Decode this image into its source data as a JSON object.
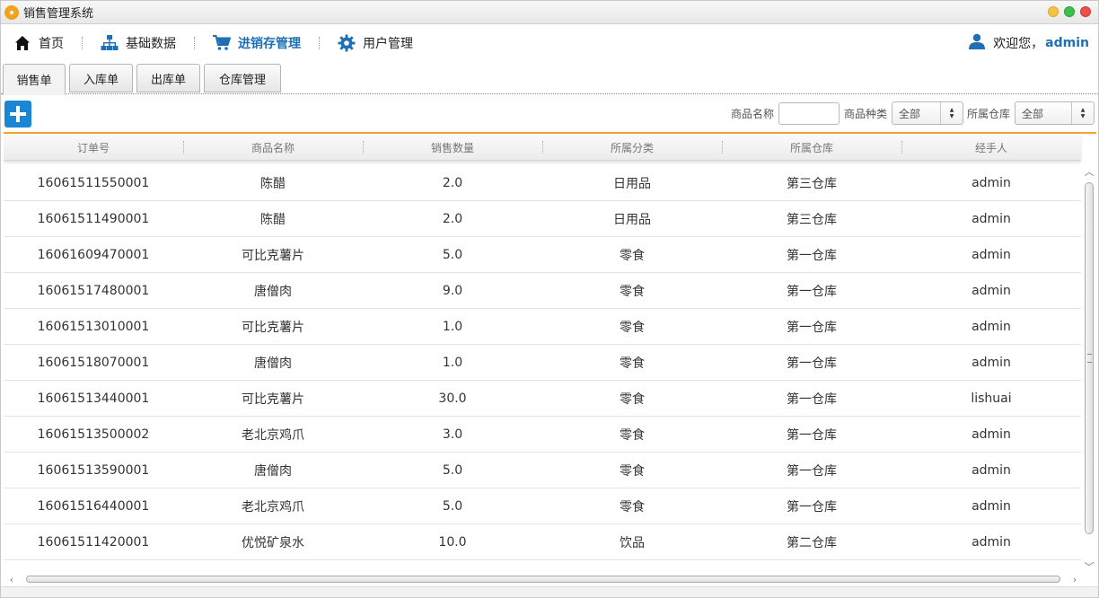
{
  "window": {
    "title": "销售管理系统"
  },
  "menu": {
    "items": [
      {
        "label": "首页",
        "icon": "home-icon"
      },
      {
        "label": "基础数据",
        "icon": "sitemap-icon"
      },
      {
        "label": "进销存管理",
        "icon": "cart-icon",
        "active": true
      },
      {
        "label": "用户管理",
        "icon": "gear-icon"
      }
    ],
    "welcome": "欢迎您，",
    "username": "admin"
  },
  "tabs": [
    {
      "label": "销售单",
      "active": true
    },
    {
      "label": "入库单"
    },
    {
      "label": "出库单"
    },
    {
      "label": "仓库管理"
    }
  ],
  "filters": {
    "product_name_label": "商品名称",
    "product_name_value": "",
    "category_label": "商品种类",
    "category_value": "全部",
    "warehouse_label": "所属仓库",
    "warehouse_value": "全部"
  },
  "table": {
    "columns": [
      "订单号",
      "商品名称",
      "销售数量",
      "所属分类",
      "所属仓库",
      "经手人"
    ],
    "rows": [
      [
        "16061511550001",
        "陈醋",
        "2.0",
        "日用品",
        "第三仓库",
        "admin"
      ],
      [
        "16061511490001",
        "陈醋",
        "2.0",
        "日用品",
        "第三仓库",
        "admin"
      ],
      [
        "16061609470001",
        "可比克薯片",
        "5.0",
        "零食",
        "第一仓库",
        "admin"
      ],
      [
        "16061517480001",
        "唐僧肉",
        "9.0",
        "零食",
        "第一仓库",
        "admin"
      ],
      [
        "16061513010001",
        "可比克薯片",
        "1.0",
        "零食",
        "第一仓库",
        "admin"
      ],
      [
        "16061518070001",
        "唐僧肉",
        "1.0",
        "零食",
        "第一仓库",
        "admin"
      ],
      [
        "16061513440001",
        "可比克薯片",
        "30.0",
        "零食",
        "第一仓库",
        "lishuai"
      ],
      [
        "16061513500002",
        "老北京鸡爪",
        "3.0",
        "零食",
        "第一仓库",
        "admin"
      ],
      [
        "16061513590001",
        "唐僧肉",
        "5.0",
        "零食",
        "第一仓库",
        "admin"
      ],
      [
        "16061516440001",
        "老北京鸡爪",
        "5.0",
        "零食",
        "第一仓库",
        "admin"
      ],
      [
        "16061511420001",
        "优悦矿泉水",
        "10.0",
        "饮品",
        "第二仓库",
        "admin"
      ]
    ]
  },
  "colors": {
    "accent": "#1e6fb4",
    "add_button": "#1c86d6",
    "table_top_border": "#f0a531"
  }
}
